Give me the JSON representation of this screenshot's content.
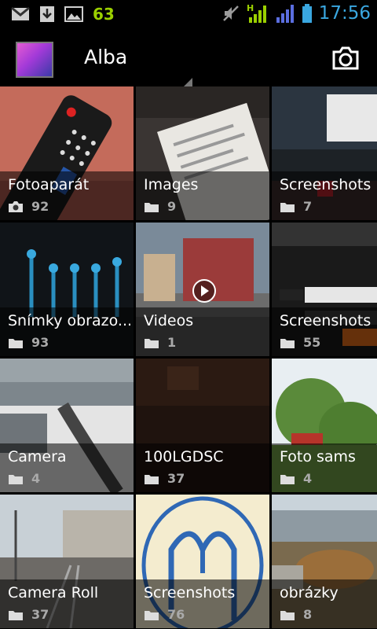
{
  "statusbar": {
    "left_icons": [
      "gmail-icon",
      "download-icon",
      "image-icon"
    ],
    "notification_count": "63",
    "network_label": "H",
    "time": "17:56"
  },
  "actionbar": {
    "title": "Alba",
    "camera_icon": "camera-icon"
  },
  "albums": [
    {
      "name": "Fotoaparát",
      "count": "92",
      "icon": "camera-icon"
    },
    {
      "name": "Images",
      "count": "9",
      "icon": "folder-icon"
    },
    {
      "name": "Screenshots",
      "count": "7",
      "icon": "folder-icon"
    },
    {
      "name": "Snímky obrazo...",
      "count": "93",
      "icon": "folder-icon"
    },
    {
      "name": "Videos",
      "count": "1",
      "icon": "folder-icon"
    },
    {
      "name": "Screenshots",
      "count": "55",
      "icon": "folder-icon"
    },
    {
      "name": "Camera",
      "count": "4",
      "icon": "folder-icon"
    },
    {
      "name": "100LGDSC",
      "count": "37",
      "icon": "folder-icon"
    },
    {
      "name": "Foto sams",
      "count": "4",
      "icon": "folder-icon"
    },
    {
      "name": "Camera Roll",
      "count": "37",
      "icon": "folder-icon"
    },
    {
      "name": "Screenshots",
      "count": "76",
      "icon": "folder-icon"
    },
    {
      "name": "obrázky",
      "count": "8",
      "icon": "folder-icon"
    }
  ]
}
